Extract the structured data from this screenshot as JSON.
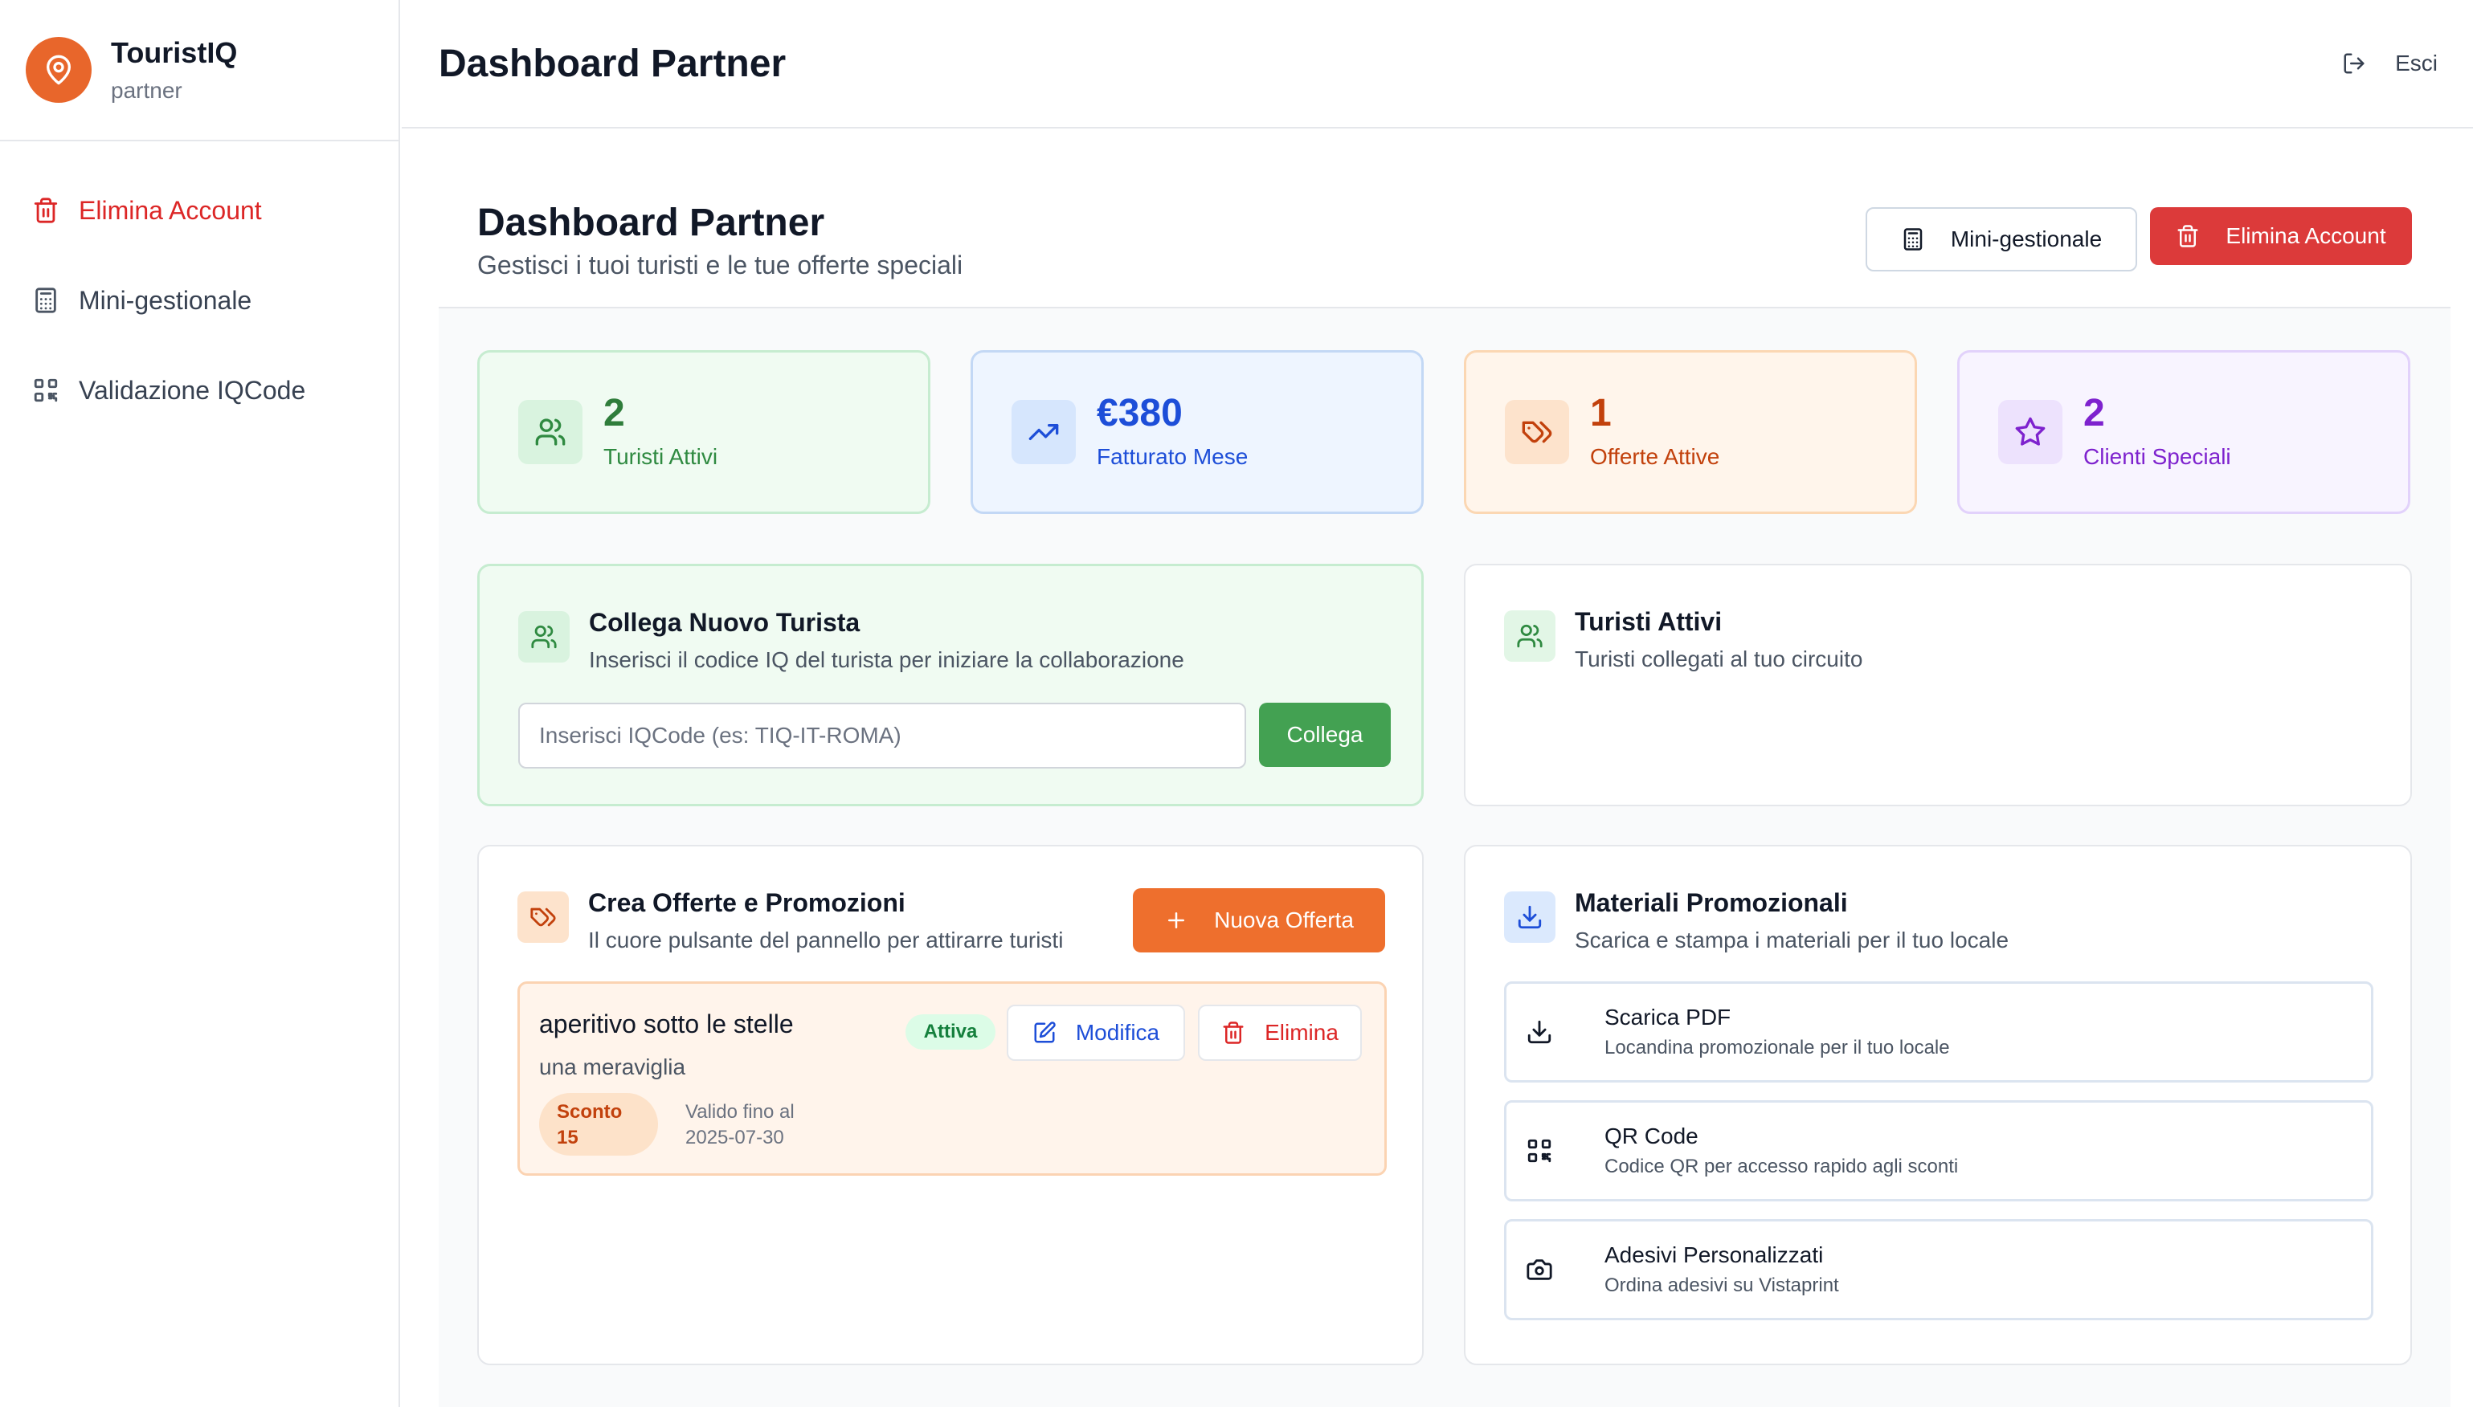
{
  "brand": {
    "name": "TouristIQ",
    "role": "partner"
  },
  "sidebar": {
    "items": [
      {
        "label": "Elimina Account",
        "icon": "trash-icon"
      },
      {
        "label": "Mini-gestionale",
        "icon": "calculator-icon"
      },
      {
        "label": "Validazione IQCode",
        "icon": "qr-code-icon"
      }
    ]
  },
  "topbar": {
    "title": "Dashboard Partner",
    "logout_label": "Esci"
  },
  "header": {
    "title": "Dashboard Partner",
    "subtitle": "Gestisci i tuoi turisti e le tue offerte speciali",
    "mini_label": "Mini-gestionale",
    "delete_label": "Elimina Account"
  },
  "stats": [
    {
      "value": "2",
      "label": "Turisti Attivi",
      "icon": "users-icon",
      "color": "#2f7d3b"
    },
    {
      "value": "€380",
      "label": "Fatturato Mese",
      "icon": "trending-up-icon",
      "color": "#1d4ed8"
    },
    {
      "value": "1",
      "label": "Offerte Attive",
      "icon": "tags-icon",
      "color": "#c2410c"
    },
    {
      "value": "2",
      "label": "Clienti Speciali",
      "icon": "star-icon",
      "color": "#7e22ce"
    }
  ],
  "connect": {
    "title": "Collega Nuovo Turista",
    "subtitle": "Inserisci il codice IQ del turista per iniziare la collaborazione",
    "placeholder": "Inserisci IQCode (es: TIQ-IT-ROMA)",
    "button": "Collega"
  },
  "tourists": {
    "title": "Turisti Attivi",
    "subtitle": "Turisti collegati al tuo circuito"
  },
  "offers": {
    "title": "Crea Offerte e Promozioni",
    "subtitle": "Il cuore pulsante del pannello per attirarre turisti",
    "new_button": "Nuova Offerta",
    "items": [
      {
        "title": "aperitivo sotto le stelle",
        "description": "una meraviglia",
        "status": "Attiva",
        "edit_label": "Modifica",
        "delete_label": "Elimina",
        "discount_label": "Sconto",
        "discount_value": "15",
        "valid_label": "Valido fino al",
        "valid_date": "2025-07-30"
      }
    ]
  },
  "materials": {
    "title": "Materiali Promozionali",
    "subtitle": "Scarica e stampa i materiali per il tuo locale",
    "items": [
      {
        "title": "Scarica PDF",
        "subtitle": "Locandina promozionale per il tuo locale",
        "icon": "download-icon"
      },
      {
        "title": "QR Code",
        "subtitle": "Codice QR per accesso rapido agli sconti",
        "icon": "qr-code-icon"
      },
      {
        "title": "Adesivi Personalizzati",
        "subtitle": "Ordina adesivi su Vistaprint",
        "icon": "camera-icon"
      }
    ]
  }
}
